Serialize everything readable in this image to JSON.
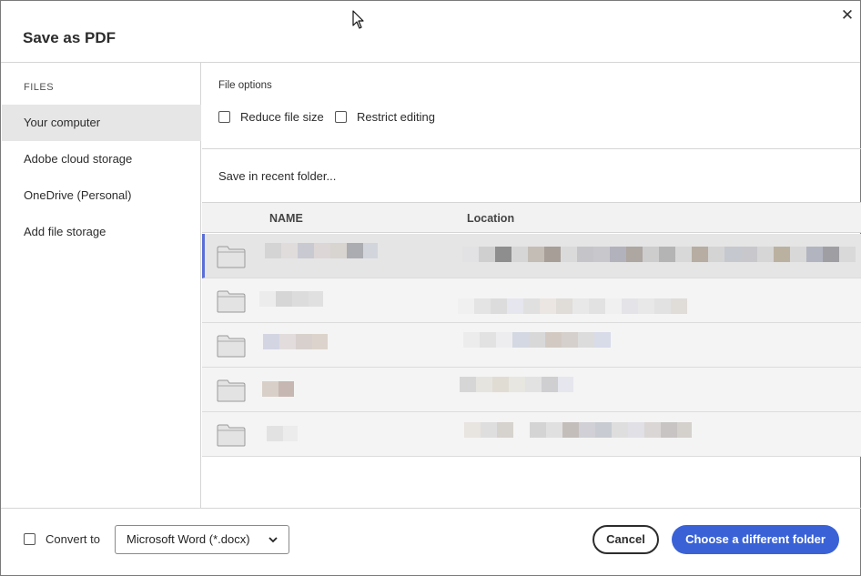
{
  "dialog": {
    "title": "Save as PDF",
    "close_icon": "close-icon"
  },
  "sidebar": {
    "heading": "FILES",
    "items": [
      {
        "label": "Your computer",
        "active": true
      },
      {
        "label": "Adobe cloud storage",
        "active": false
      },
      {
        "label": "OneDrive (Personal)",
        "active": false
      },
      {
        "label": "Add file storage",
        "active": false
      }
    ]
  },
  "file_options": {
    "label": "File options",
    "reduce_size_label": "Reduce file size",
    "reduce_size_checked": false,
    "restrict_editing_label": "Restrict editing",
    "restrict_editing_checked": false
  },
  "recent_folder": {
    "label": "Save in recent folder..."
  },
  "table": {
    "columns": [
      "NAME",
      "Location"
    ],
    "rows": [
      {
        "icon": "folder-icon",
        "selected": true,
        "name": "",
        "location": ""
      },
      {
        "icon": "folder-icon",
        "selected": false,
        "name": "",
        "location": ""
      },
      {
        "icon": "folder-icon",
        "selected": false,
        "name": "",
        "location": ""
      },
      {
        "icon": "folder-icon",
        "selected": false,
        "name": "",
        "location": ""
      },
      {
        "icon": "folder-icon",
        "selected": false,
        "name": "",
        "location": ""
      }
    ]
  },
  "footer": {
    "convert_label": "Convert to",
    "convert_checked": false,
    "format_value": "Microsoft Word (*.docx)",
    "cancel_label": "Cancel",
    "primary_label": "Choose a different folder"
  },
  "colors": {
    "accent": "#3a62d6",
    "selection_bar": "#5a6ed8",
    "sidebar_active": "#e6e6e6"
  }
}
